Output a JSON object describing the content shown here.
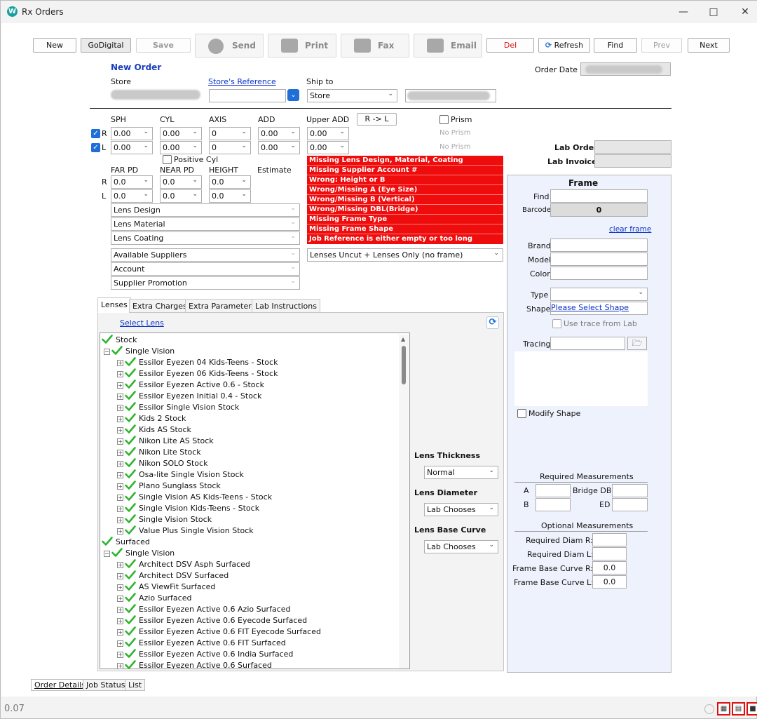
{
  "window": {
    "title": "Rx Orders",
    "logo": "W"
  },
  "toolbar": {
    "new": "New",
    "godigital": "GoDigital",
    "save": "Save",
    "send": "Send",
    "print": "Print",
    "fax": "Fax",
    "email": "Email",
    "del": "Del",
    "refresh": "Refresh",
    "find": "Find",
    "prev": "Prev",
    "next": "Next"
  },
  "header": {
    "title": "New Order",
    "order_date_label": "Order Date",
    "store_label": "Store",
    "store_ref_label": "Store's Reference",
    "ship_to_label": "Ship to",
    "ship_to_value": "Store"
  },
  "rx": {
    "cols": [
      "SPH",
      "CYL",
      "AXIS",
      "ADD",
      "Upper ADD"
    ],
    "swap_button": "R -> L",
    "prism_label": "Prism",
    "no_prism_r": "No Prism",
    "no_prism_l": "No Prism",
    "r_label": "R",
    "l_label": "L",
    "r": {
      "sph": "0.00",
      "cyl": "0.00",
      "axis": "0",
      "add": "0.00",
      "upper_add": "0.00"
    },
    "l": {
      "sph": "0.00",
      "cyl": "0.00",
      "axis": "0",
      "add": "0.00",
      "upper_add": "0.00"
    },
    "positive_cyl": "Positive Cyl",
    "pd_cols": [
      "FAR PD",
      "NEAR PD",
      "HEIGHT",
      "Estimate"
    ],
    "pd_r": {
      "far": "0.0",
      "near": "0.0",
      "height": "0.0"
    },
    "pd_l": {
      "far": "0.0",
      "near": "0.0",
      "height": "0.0"
    }
  },
  "errors": [
    "Missing Lens Design, Material, Coating",
    "Missing Supplier Account #",
    "Wrong: Height or B",
    "Wrong/Missing A (Eye Size)",
    "Wrong/Missing B (Vertical)",
    "Wrong/Missing DBL(Bridge)",
    "Missing Frame Type",
    "Missing Frame Shape",
    "Job Reference is either empty or too long"
  ],
  "lens_selects": {
    "design": "Lens Design",
    "material": "Lens Material",
    "coating": "Lens Coating",
    "suppliers": "Available Suppliers",
    "account": "Account",
    "promotion": "Supplier Promotion",
    "uncut": "Lenses Uncut + Lenses Only (no frame)"
  },
  "lab": {
    "order_label": "Lab Order",
    "invoice_label": "Lab Invoice"
  },
  "tabs": [
    "Lenses",
    "Extra Charges",
    "Extra Parameters",
    "Lab Instructions"
  ],
  "select_lens": "Select Lens",
  "tree": [
    {
      "level": 0,
      "label": "Stock"
    },
    {
      "level": 1,
      "label": "Single Vision"
    },
    {
      "level": 2,
      "label": "Essilor Eyezen 04 Kids-Teens - Stock"
    },
    {
      "level": 2,
      "label": "Essilor Eyezen 06 Kids-Teens - Stock"
    },
    {
      "level": 2,
      "label": "Essilor Eyezen Active 0.6 - Stock"
    },
    {
      "level": 2,
      "label": "Essilor Eyezen Initial 0.4 - Stock"
    },
    {
      "level": 2,
      "label": "Essilor Single Vision Stock"
    },
    {
      "level": 2,
      "label": "Kids 2 Stock"
    },
    {
      "level": 2,
      "label": "Kids AS Stock"
    },
    {
      "level": 2,
      "label": "Nikon Lite AS Stock"
    },
    {
      "level": 2,
      "label": "Nikon Lite Stock"
    },
    {
      "level": 2,
      "label": "Nikon SOLO Stock"
    },
    {
      "level": 2,
      "label": "Osa-lite Single Vision Stock"
    },
    {
      "level": 2,
      "label": "Plano Sunglass Stock"
    },
    {
      "level": 2,
      "label": "Single Vision AS Kids-Teens -  Stock"
    },
    {
      "level": 2,
      "label": "Single Vision Kids-Teens -  Stock"
    },
    {
      "level": 2,
      "label": "Single Vision Stock"
    },
    {
      "level": 2,
      "label": "Value Plus Single Vision Stock"
    },
    {
      "level": 0,
      "label": "Surfaced"
    },
    {
      "level": 1,
      "label": "Single Vision"
    },
    {
      "level": 2,
      "label": "Architect DSV Asph Surfaced"
    },
    {
      "level": 2,
      "label": "Architect DSV Surfaced"
    },
    {
      "level": 2,
      "label": "AS ViewFit Surfaced"
    },
    {
      "level": 2,
      "label": "Azio Surfaced"
    },
    {
      "level": 2,
      "label": "Essilor Eyezen Active 0.6 Azio Surfaced"
    },
    {
      "level": 2,
      "label": "Essilor Eyezen Active 0.6 Eyecode Surfaced"
    },
    {
      "level": 2,
      "label": "Essilor Eyezen Active 0.6 FIT Eyecode Surfaced"
    },
    {
      "level": 2,
      "label": "Essilor Eyezen Active 0.6 FIT Surfaced"
    },
    {
      "level": 2,
      "label": "Essilor Eyezen Active 0.6 India Surfaced"
    },
    {
      "level": 2,
      "label": "Essilor Eyezen Active 0.6 Surfaced"
    }
  ],
  "lens_opts": {
    "thickness_label": "Lens Thickness",
    "thickness": "Normal",
    "diameter_label": "Lens Diameter",
    "diameter": "Lab Chooses",
    "base_curve_label": "Lens Base Curve",
    "base_curve": "Lab Chooses"
  },
  "frame": {
    "title": "Frame",
    "find_label": "Find",
    "barcode_label": "Barcode",
    "barcode": "0",
    "clear": "clear frame",
    "brand_label": "Brand",
    "model_label": "Model",
    "color_label": "Color",
    "type_label": "Type",
    "shape_label": "Shape",
    "shape_link": "Please Select Shape",
    "use_trace": "Use trace from Lab",
    "tracing_label": "Tracing",
    "modify_shape": "Modify Shape",
    "req_title": "Required Measurements",
    "a_label": "A",
    "bridge_label": "Bridge DBL",
    "b_label": "B",
    "ed_label": "ED",
    "opt_title": "Optional Measurements",
    "diam_r_label": "Required Diam R:",
    "diam_l_label": "Required Diam L:",
    "fbc_r_label": "Frame Base Curve R:",
    "fbc_r": "0.0",
    "fbc_l_label": "Frame Base Curve L:",
    "fbc_l": "0.0"
  },
  "bottom_tabs": [
    "Order Details",
    "Job Status",
    "List"
  ],
  "version": "0.07",
  "colors": {
    "error_red": "#ee0c0c",
    "check_green": "#2db52d",
    "title_blue": "#1a3fbf"
  }
}
